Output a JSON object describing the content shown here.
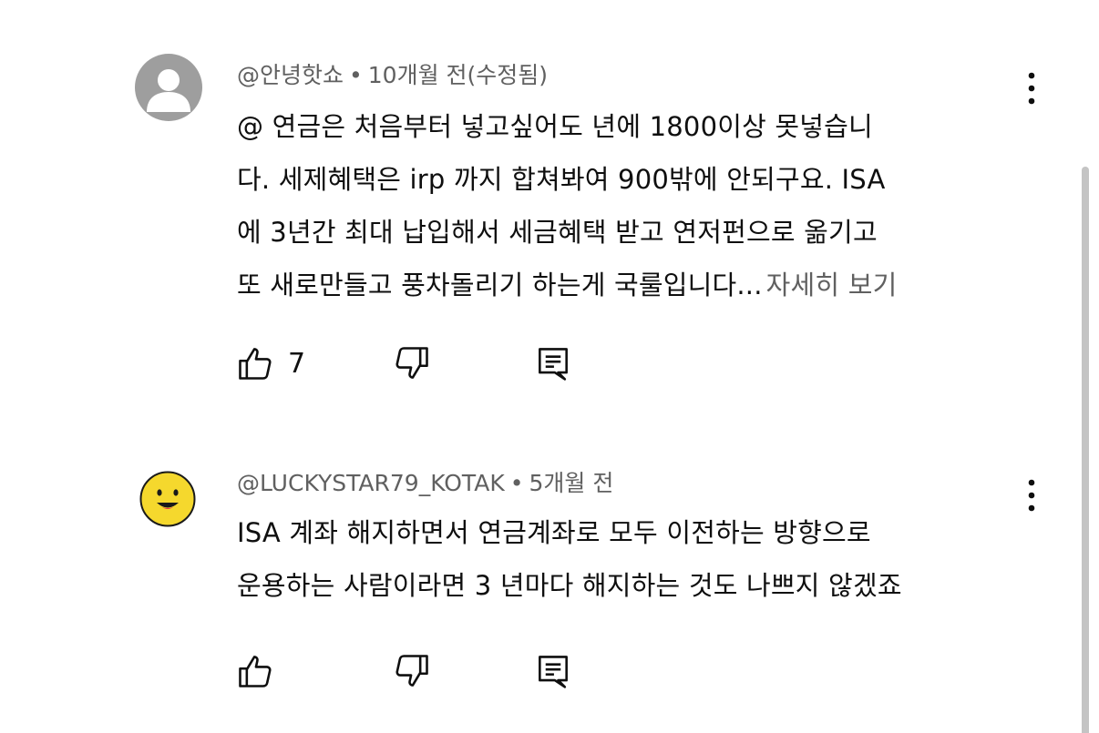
{
  "comments": [
    {
      "author": "@안녕핫쇼",
      "time": "10개월 전(수정됨)",
      "lines": [
        "@ 연금은 처음부터 넣고싶어도 년에 1800이상 못넣습니",
        "다. 세제혜택은 irp 까지 합쳐봐여 900밖에 안되구요. ISA",
        "에 3년간 최대 납입해서 세금혜택 받고 연저펀으로 옮기고",
        "또 새로만들고 풍차돌리기 하는게 국룰입니다..."
      ],
      "more_label": "자세히 보기",
      "like_count": "7",
      "avatar": "default-gray-avatar"
    },
    {
      "author": "@LUCKYSTAR79_KOTAK",
      "time": "5개월 전",
      "lines": [
        "ISA 계좌 해지하면서 연금계좌로 모두 이전하는 방향으로",
        "운용하는 사람이라면 3 년마다 해지하는 것도 나쁘지 않겠죠"
      ],
      "avatar": "smiley-face-avatar"
    }
  ],
  "meta_separator": "•",
  "colors": {
    "text_primary": "#0f0f0f",
    "text_secondary": "#606060",
    "avatar_gray": "#9e9e9e",
    "smiley_yellow": "#f5d82d"
  },
  "icons": [
    "like-icon",
    "dislike-icon",
    "reply-icon",
    "more-vert-icon"
  ]
}
